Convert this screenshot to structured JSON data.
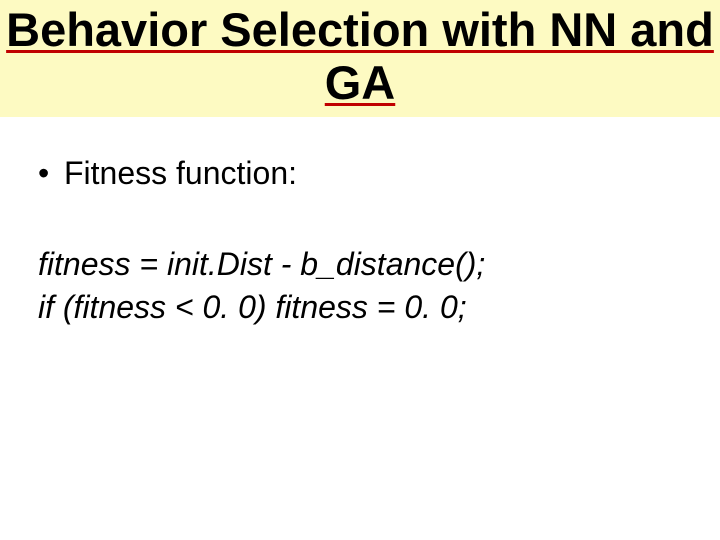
{
  "title": "Behavior Selection with NN and GA",
  "bullets": [
    "Fitness function:"
  ],
  "code_lines": [
    "fitness = init.Dist - b_distance();",
    "if (fitness < 0. 0) fitness = 0. 0;"
  ]
}
